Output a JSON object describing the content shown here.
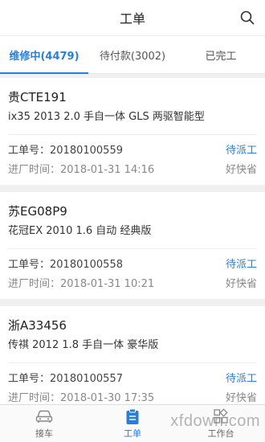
{
  "header": {
    "title": "工单"
  },
  "tabs": [
    {
      "label": "维修中(4479)",
      "active": true
    },
    {
      "label": "待付款(3002)",
      "active": false
    },
    {
      "label": "已完工",
      "active": false
    }
  ],
  "orders": [
    {
      "plate": "贵CTE191",
      "model": "ix35 2013 2.0 手自一体 GLS 两驱智能型",
      "order_no": "工单号：20180100559",
      "status": "待派工",
      "entry_time": "进厂时间：2018-01-31 14:16",
      "shop": "好快省"
    },
    {
      "plate": "苏EG08P9",
      "model": "花冠EX 2010 1.6 自动 经典版",
      "order_no": "工单号：20180100558",
      "status": "待派工",
      "entry_time": "进厂时间：2018-01-31 10:21",
      "shop": "好快省"
    },
    {
      "plate": "浙A33456",
      "model": "传祺 2012 1.8 手自一体 豪华版",
      "order_no": "工单号：20180100557",
      "status": "待派工",
      "entry_time": "进厂时间：2018-01-30 17:35",
      "shop": "好快省"
    }
  ],
  "bottom_nav": [
    {
      "label": "接车",
      "icon": "car-icon",
      "active": false
    },
    {
      "label": "工单",
      "icon": "clipboard-icon",
      "active": true
    },
    {
      "label": "工作台",
      "icon": "grid-icon",
      "active": false
    }
  ],
  "watermark": "xfdown.com",
  "colors": {
    "accent": "#2a7fd4",
    "background": "#f0f0f0"
  }
}
